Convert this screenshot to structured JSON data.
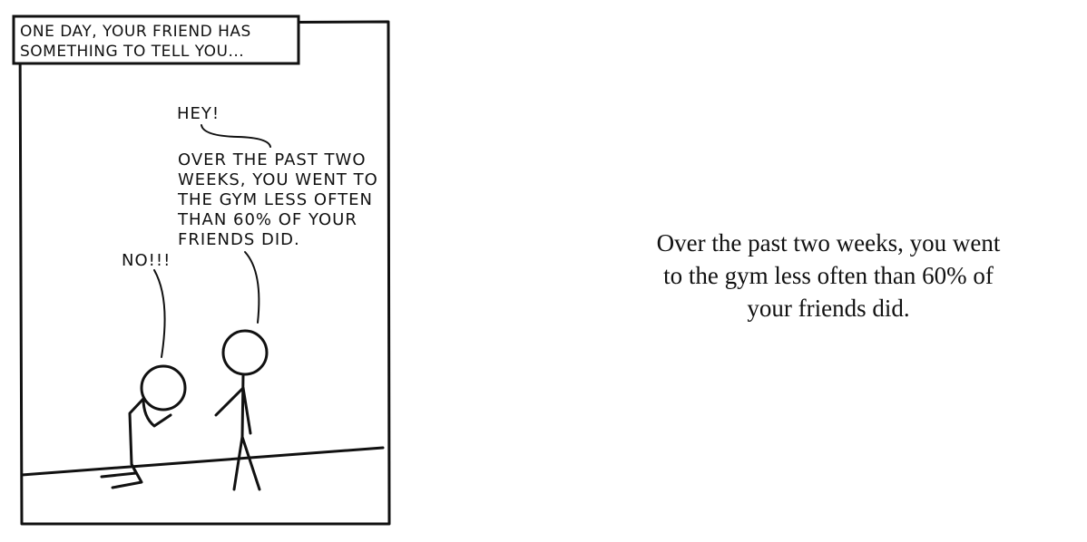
{
  "comic": {
    "caption": {
      "line1": "ONE DAY, YOUR FRIEND HAS",
      "line2": "SOMETHING TO TELL YOU..."
    },
    "speech": {
      "hey": "HEY!",
      "line1": "OVER THE PAST TWO",
      "line2": "WEEKS, YOU WENT TO",
      "line3": "THE GYM LESS OFTEN",
      "line4": "THAN 60% OF YOUR",
      "line5": "FRIENDS DID.",
      "reply": "NO!!!"
    }
  },
  "side_text": {
    "line1": "Over the past two weeks, you went",
    "line2": "to the gym less often than 60% of",
    "line3": "your friends did."
  }
}
